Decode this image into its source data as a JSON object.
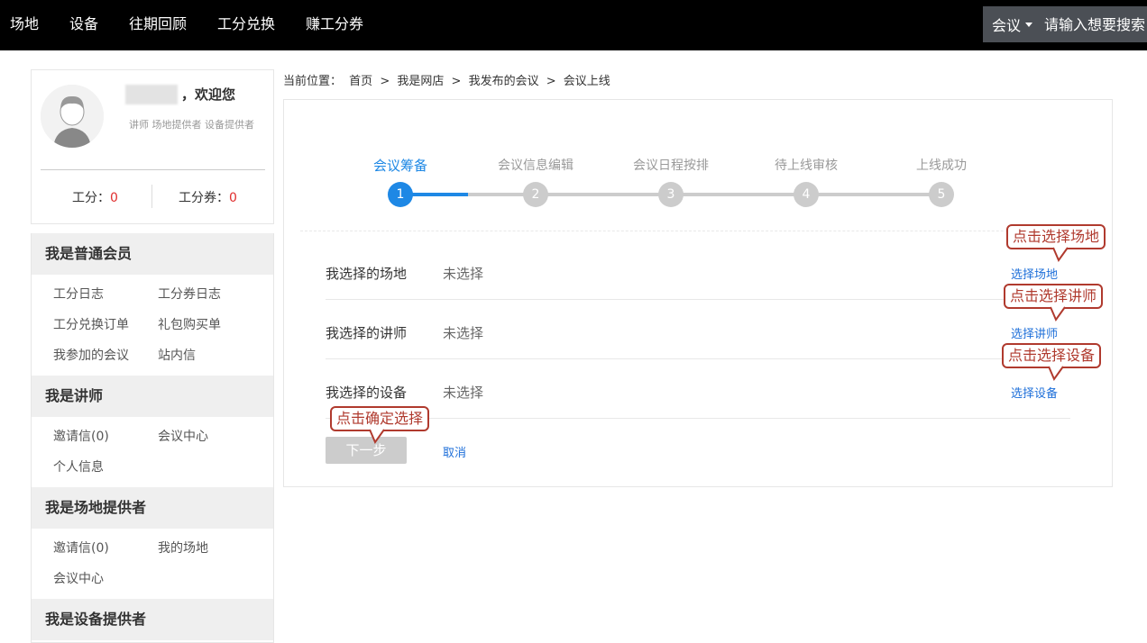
{
  "nav": {
    "items": [
      "场地",
      "设备",
      "往期回顾",
      "工分兑换",
      "赚工分券"
    ],
    "search_category": "会议",
    "search_placeholder": "请输入想要搜索"
  },
  "profile": {
    "welcome": "，欢迎您",
    "roles": "讲师 场地提供者 设备提供者",
    "points_label": "工分：",
    "points_value": "0",
    "coupons_label": "工分券：",
    "coupons_value": "0"
  },
  "sidebar": {
    "groups": [
      {
        "title": "我是普通会员",
        "links": [
          "工分日志",
          "工分券日志",
          "工分兑换订单",
          "礼包购买单",
          "我参加的会议",
          "站内信"
        ]
      },
      {
        "title": "我是讲师",
        "links": [
          "邀请信(0)",
          "会议中心",
          "个人信息"
        ]
      },
      {
        "title": "我是场地提供者",
        "links": [
          "邀请信(0)",
          "我的场地",
          "会议中心"
        ]
      },
      {
        "title": "我是设备提供者",
        "links": []
      }
    ]
  },
  "breadcrumb": {
    "prefix": "当前位置：",
    "items": [
      "首页",
      "我是网店",
      "我发布的会议",
      "会议上线"
    ],
    "separator": ">"
  },
  "steps": [
    {
      "num": "1",
      "label": "会议筹备",
      "active": true
    },
    {
      "num": "2",
      "label": "会议信息编辑",
      "active": false
    },
    {
      "num": "3",
      "label": "会议日程按排",
      "active": false
    },
    {
      "num": "4",
      "label": "待上线审核",
      "active": false
    },
    {
      "num": "5",
      "label": "上线成功",
      "active": false
    }
  ],
  "rows": [
    {
      "label": "我选择的场地",
      "value": "未选择",
      "link": "选择场地",
      "callout": "点击选择场地"
    },
    {
      "label": "我选择的讲师",
      "value": "未选择",
      "link": "选择讲师",
      "callout": "点击选择讲师"
    },
    {
      "label": "我选择的设备",
      "value": "未选择",
      "link": "选择设备",
      "callout": "点击选择设备"
    }
  ],
  "actions": {
    "next": "下一步",
    "cancel": "取消",
    "next_callout": "点击确定选择"
  },
  "colors": {
    "accent": "#1e88e5",
    "callout": "#b03a2e",
    "points": "#e02e2e"
  }
}
